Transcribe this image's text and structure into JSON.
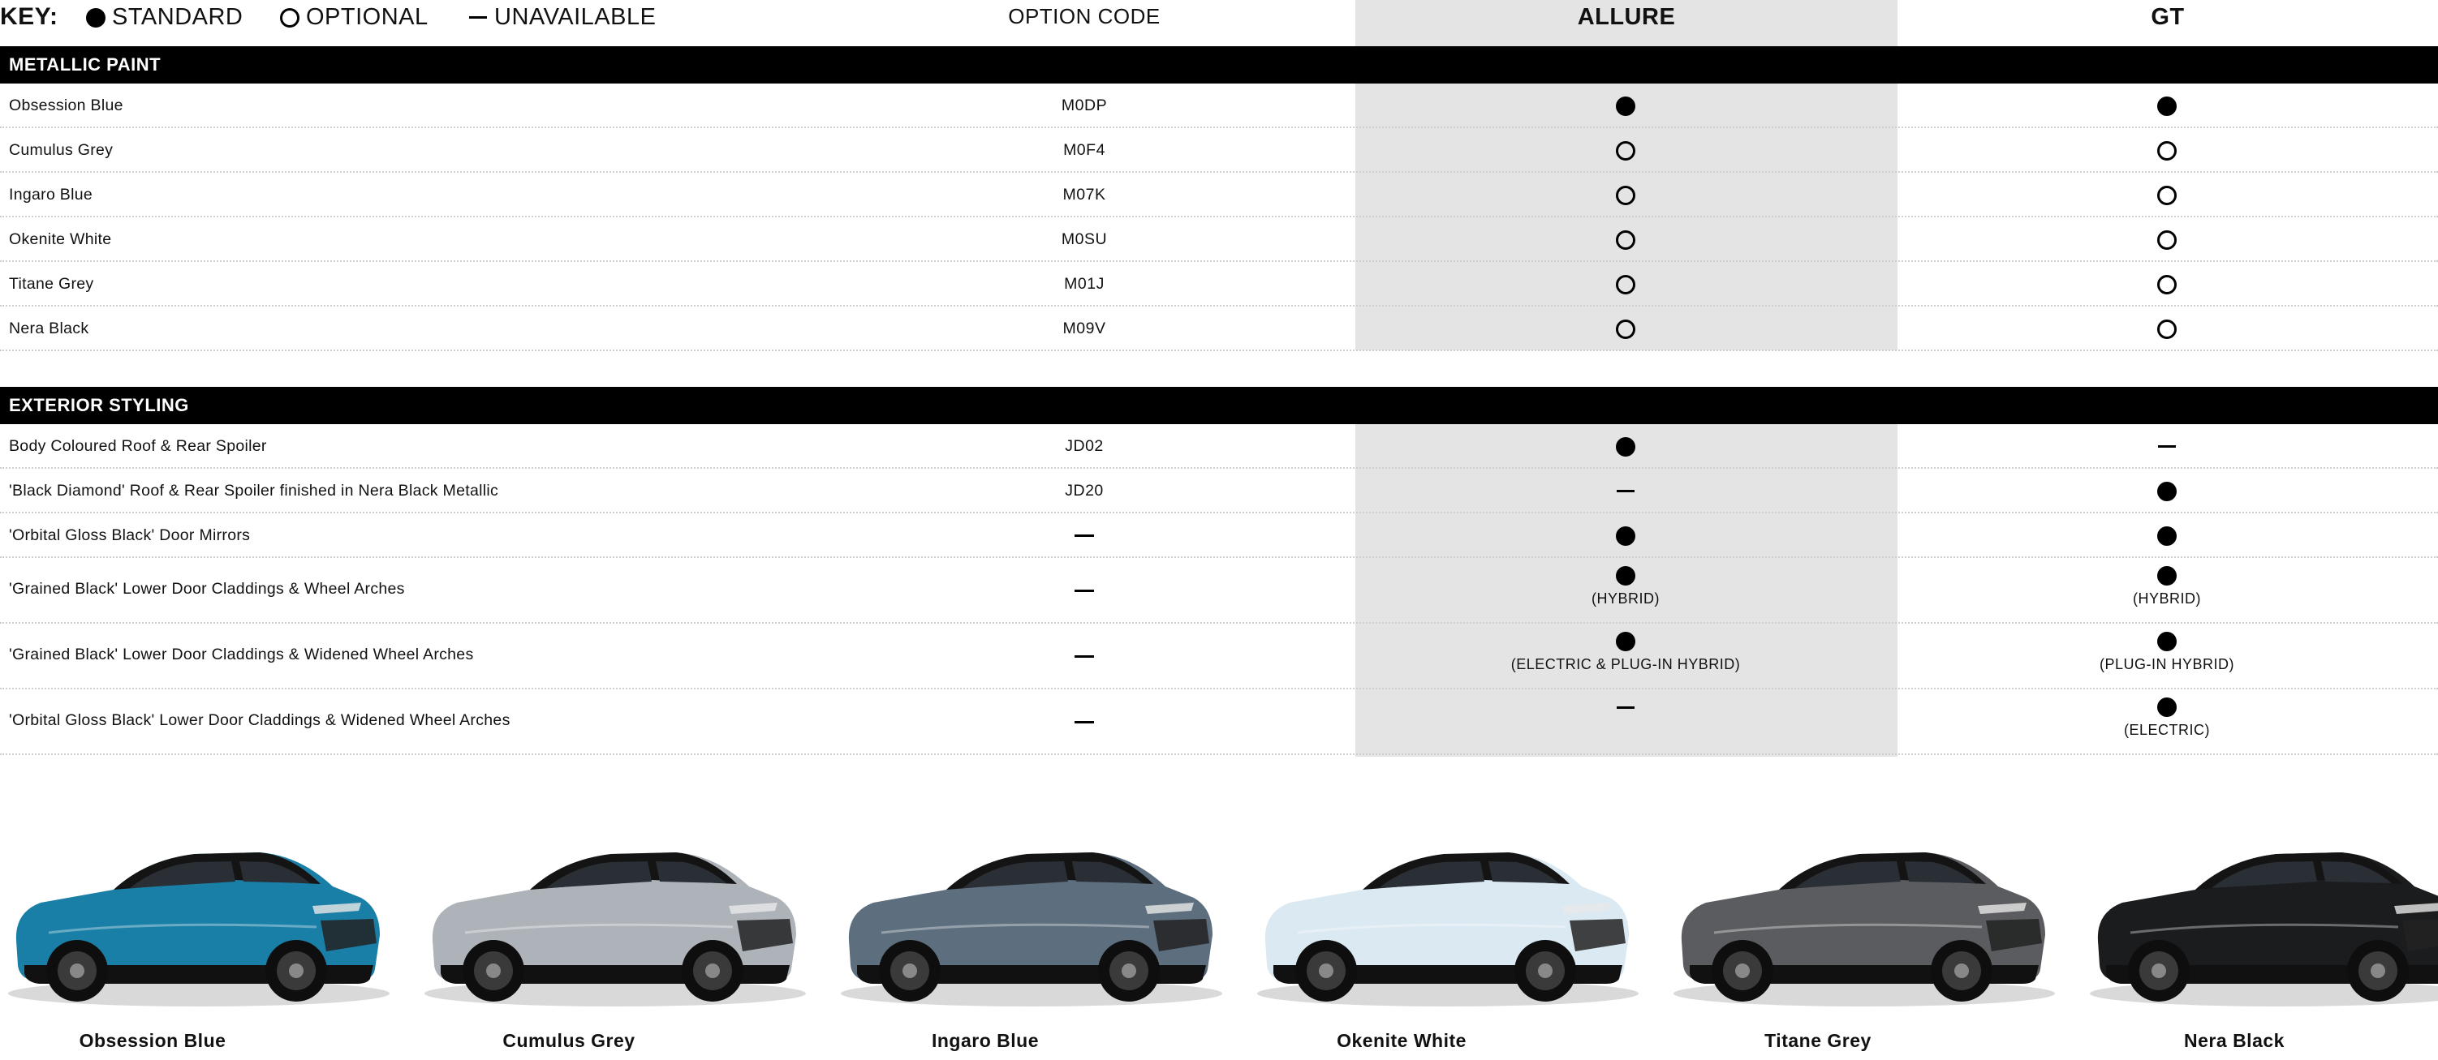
{
  "key": {
    "title": "KEY:",
    "standard": "STANDARD",
    "optional": "OPTIONAL",
    "unavailable": "UNAVAILABLE"
  },
  "columns": {
    "option_code": "OPTION CODE",
    "allure": "ALLURE",
    "gt": "GT"
  },
  "metallic_paint": {
    "title": "METALLIC PAINT",
    "rows": [
      {
        "label": "Obsession Blue",
        "code": "M0DP",
        "allure": "standard",
        "gt": "standard"
      },
      {
        "label": "Cumulus Grey",
        "code": "M0F4",
        "allure": "optional",
        "gt": "optional"
      },
      {
        "label": "Ingaro Blue",
        "code": "M07K",
        "allure": "optional",
        "gt": "optional"
      },
      {
        "label": "Okenite White",
        "code": "M0SU",
        "allure": "optional",
        "gt": "optional"
      },
      {
        "label": "Titane Grey",
        "code": "M01J",
        "allure": "optional",
        "gt": "optional"
      },
      {
        "label": "Nera Black",
        "code": "M09V",
        "allure": "optional",
        "gt": "optional"
      }
    ]
  },
  "exterior_styling": {
    "title": "EXTERIOR STYLING",
    "rows": [
      {
        "label": "Body Coloured Roof & Rear Spoiler",
        "code": "JD02",
        "allure": "standard",
        "gt": "unavailable"
      },
      {
        "label": "'Black Diamond' Roof & Rear Spoiler finished in Nera Black Metallic",
        "code": "JD20",
        "allure": "unavailable",
        "gt": "standard"
      },
      {
        "label": "'Orbital Gloss Black' Door Mirrors",
        "code": "",
        "allure": "standard",
        "gt": "standard"
      },
      {
        "label": "'Grained Black' Lower Door Claddings & Wheel Arches",
        "code": "",
        "allure": "standard",
        "allure_note": "(HYBRID)",
        "gt": "standard",
        "gt_note": "(HYBRID)"
      },
      {
        "label": "'Grained Black' Lower Door Claddings & Widened Wheel Arches",
        "code": "",
        "allure": "standard",
        "allure_note": "(ELECTRIC & PLUG-IN HYBRID)",
        "gt": "standard",
        "gt_note": "(PLUG-IN HYBRID)"
      },
      {
        "label": "'Orbital Gloss Black' Lower Door Claddings & Widened Wheel Arches",
        "code": "",
        "allure": "unavailable",
        "gt": "standard",
        "gt_note": "(ELECTRIC)"
      }
    ]
  },
  "gallery": [
    {
      "name": "Obsession Blue",
      "color": "#1a7fa6"
    },
    {
      "name": "Cumulus Grey",
      "color": "#aeb3ba"
    },
    {
      "name": "Ingaro Blue",
      "color": "#5d6e7e"
    },
    {
      "name": "Okenite White",
      "color": "#dbe9f2"
    },
    {
      "name": "Titane Grey",
      "color": "#5a5c5f"
    },
    {
      "name": "Nera Black",
      "color": "#1b1c1e"
    }
  ]
}
